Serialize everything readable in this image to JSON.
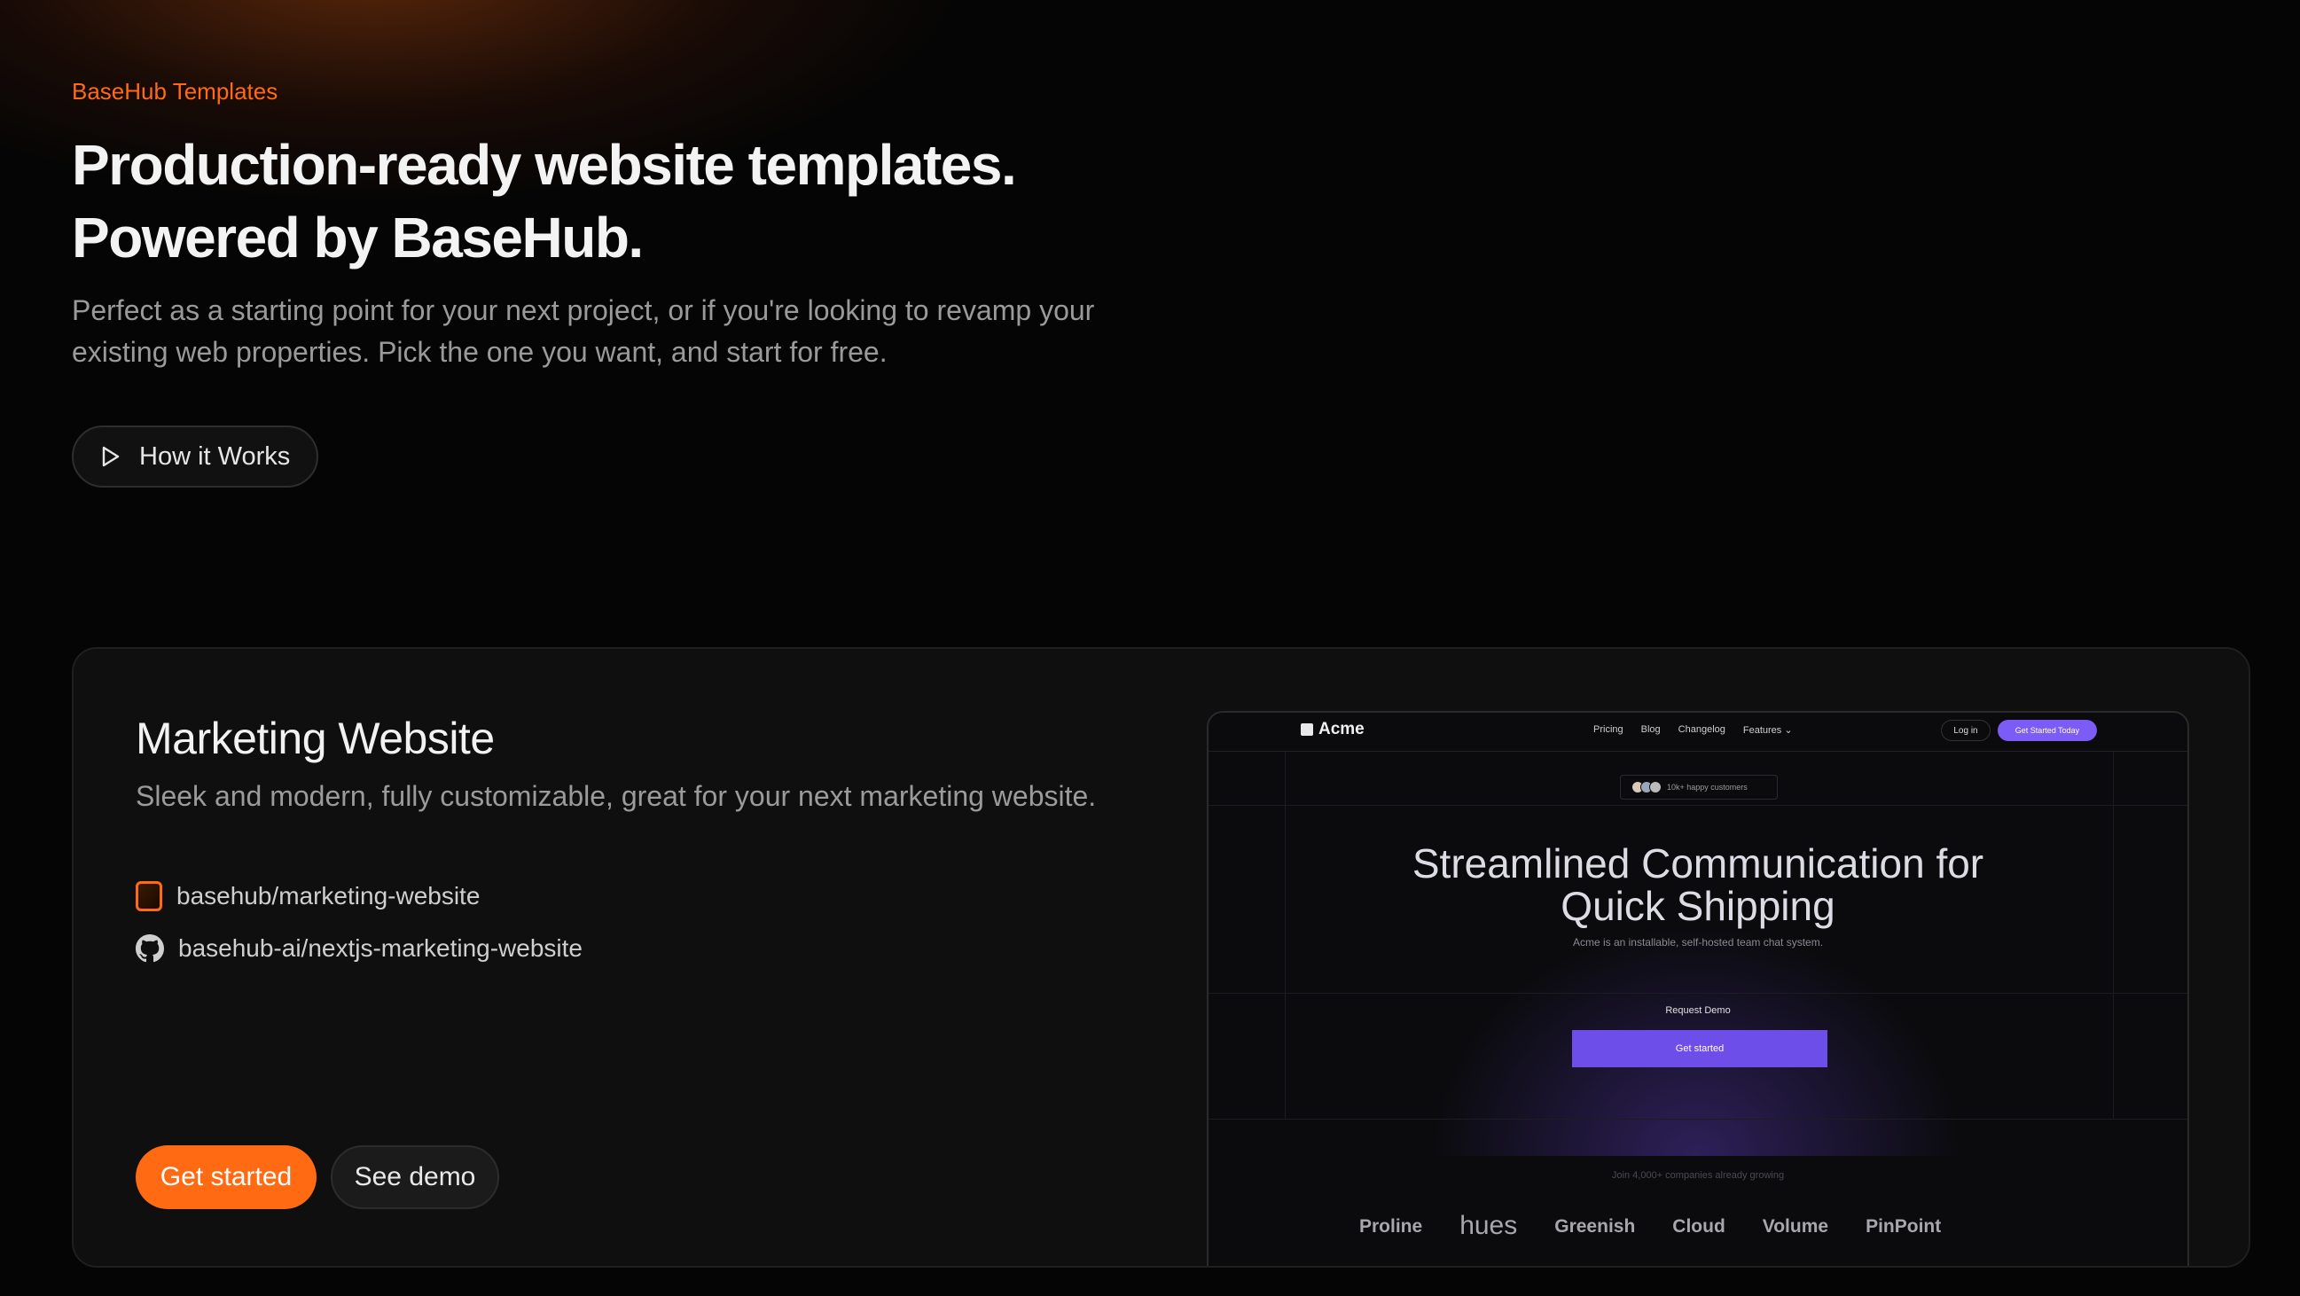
{
  "hero": {
    "eyebrow": "BaseHub Templates",
    "headline_line1": "Production-ready website templates.",
    "headline_line2": "Powered by BaseHub.",
    "subtitle": "Perfect as a starting point for your next project, or if you're looking to revamp your existing web properties. Pick the one you want, and start for free.",
    "how_button": "How it Works"
  },
  "card": {
    "title": "Marketing Website",
    "description": "Sleek and modern, fully customizable, great for your next marketing website.",
    "repos": [
      {
        "label": "basehub/marketing-website",
        "icon": "basehub-icon"
      },
      {
        "label": "basehub-ai/nextjs-marketing-website",
        "icon": "github-icon"
      }
    ],
    "primary_button": "Get started",
    "secondary_button": "See demo"
  },
  "preview": {
    "logo": "Acme",
    "nav_links": [
      "Pricing",
      "Blog",
      "Changelog",
      "Features ⌄"
    ],
    "login": "Log in",
    "cta": "Get Started Today",
    "badge": "10k+ happy customers",
    "headline_line1": "Streamlined Communication for",
    "headline_line2": "Quick Shipping",
    "subhead": "Acme is an installable, self-hosted team chat system.",
    "request_demo": "Request Demo",
    "get_started": "Get started",
    "join_text": "Join 4,000+ companies already growing",
    "logos": [
      "Proline",
      "hues",
      "Greenish",
      "Cloud",
      "Volume",
      "PinPoint"
    ]
  },
  "colors": {
    "accent": "#ff6a13",
    "preview_accent": "#7c5cf6",
    "background": "#050505"
  }
}
